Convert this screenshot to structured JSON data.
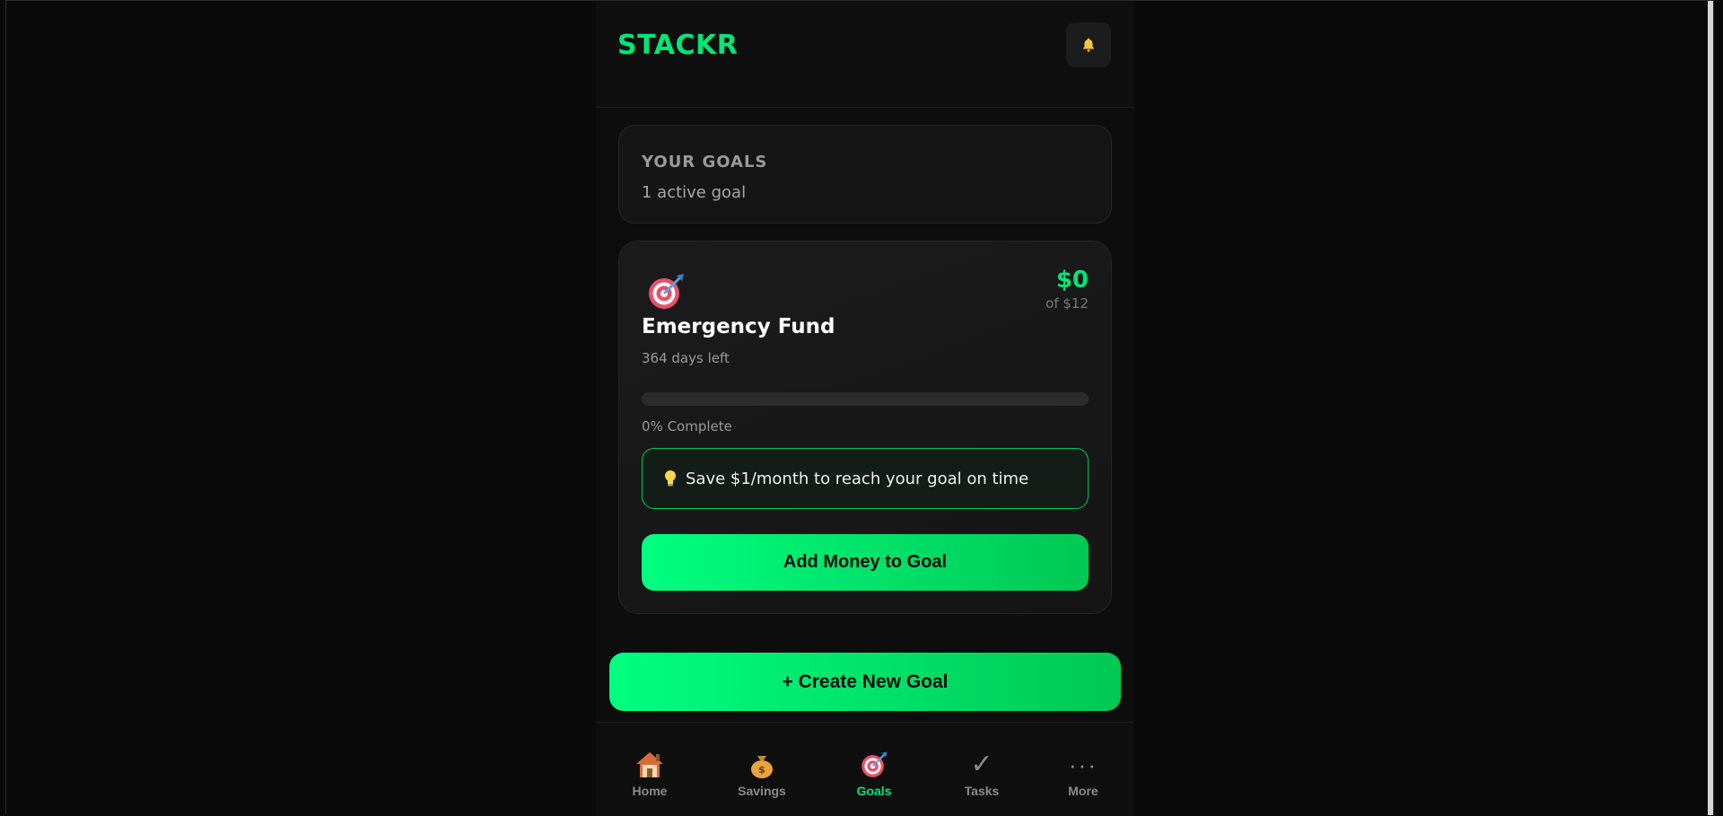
{
  "app": {
    "logo": "STACKR",
    "notifications_icon": "bell-icon"
  },
  "summary": {
    "title": "YOUR GOALS",
    "subtitle": "1 active goal"
  },
  "goal": {
    "icon": "target-icon",
    "name": "Emergency Fund",
    "days_left": "364 days left",
    "saved": "$0",
    "target": "of $12",
    "progress_fraction": 0,
    "progress_label": "0% Complete",
    "tip_icon": "lightbulb-icon",
    "tip": "Save $1/month to reach your goal on time",
    "add_button": "Add Money to Goal"
  },
  "create_button": "+ Create New Goal",
  "nav": {
    "items": [
      {
        "label": "Home",
        "icon": "home-icon",
        "active": false
      },
      {
        "label": "Savings",
        "icon": "money-bag-icon",
        "active": false
      },
      {
        "label": "Goals",
        "icon": "target-icon",
        "active": true
      },
      {
        "label": "Tasks",
        "icon": "checkmark-icon",
        "active": false
      },
      {
        "label": "More",
        "icon": "more-dots-icon",
        "active": false
      }
    ]
  },
  "colors": {
    "accent": "#00e676",
    "background": "#0a0a0a",
    "card": "#151515"
  }
}
